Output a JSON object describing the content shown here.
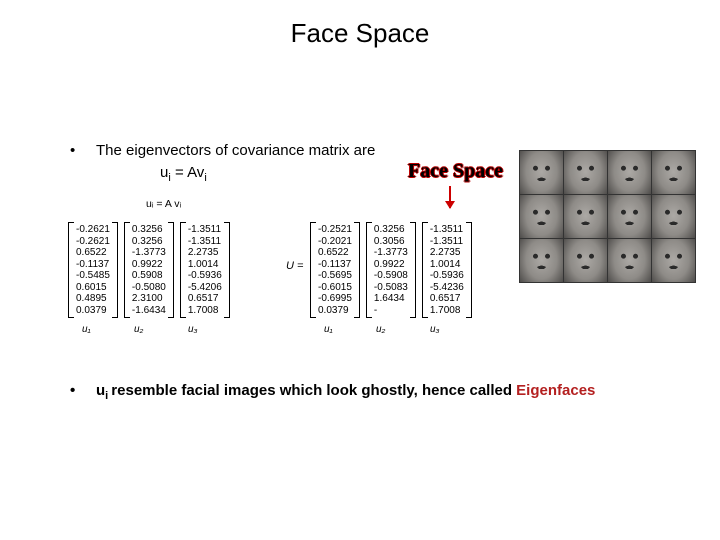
{
  "title": "Face Space",
  "bullet1": "The eigenvectors of covariance matrix are",
  "formula_left": "u",
  "formula_i1": "i",
  "formula_eq": " = Av",
  "formula_i2": "i",
  "eq_small": "uᵢ = A vᵢ",
  "face_space_label": "Face Space",
  "u_equals": "U =",
  "vectors_left": {
    "u1": [
      "-0.2621",
      "-0.2621",
      "0.6522",
      "-0.1137",
      "-0.5485",
      "0.6015",
      "0.4895",
      "0.0379"
    ],
    "u2": [
      "0.3256",
      "0.3256",
      "-1.3773",
      "0.9922",
      "0.5908",
      "-0.5080",
      "2.3100",
      "-1.6434"
    ],
    "u3": [
      "-1.3511",
      "-1.3511",
      "2.2735",
      "1.0014",
      "-0.5936",
      "-5.4206",
      "0.6517",
      "1.7008"
    ]
  },
  "labels_left": {
    "u1": "u₁",
    "u2": "u₂",
    "u3": "u₃"
  },
  "vectors_right": {
    "u1": [
      "-0.2521",
      "-0.2021",
      "0.6522",
      "-0.1137",
      "-0.5695",
      "-0.6015",
      "-0.6995",
      "0.0379"
    ],
    "u2": [
      "0.3256",
      "0.3056",
      "-1.3773",
      "0.9922",
      "-0.5908",
      "-0.5083",
      "1.6434",
      "-"
    ],
    "u3": [
      "-1.3511",
      "-1.3511",
      "2.2735",
      "1.0014",
      "-0.5936",
      "-5.4236",
      "0.6517",
      "1.7008"
    ]
  },
  "labels_right": {
    "u1": "u₁",
    "u2": "u₂",
    "u3": "u₃"
  },
  "bullet2_prefix": "u",
  "bullet2_sub": "i ",
  "bullet2_rest": "resemble facial images which look ghostly, hence called ",
  "eigenfaces": "Eigenfaces"
}
